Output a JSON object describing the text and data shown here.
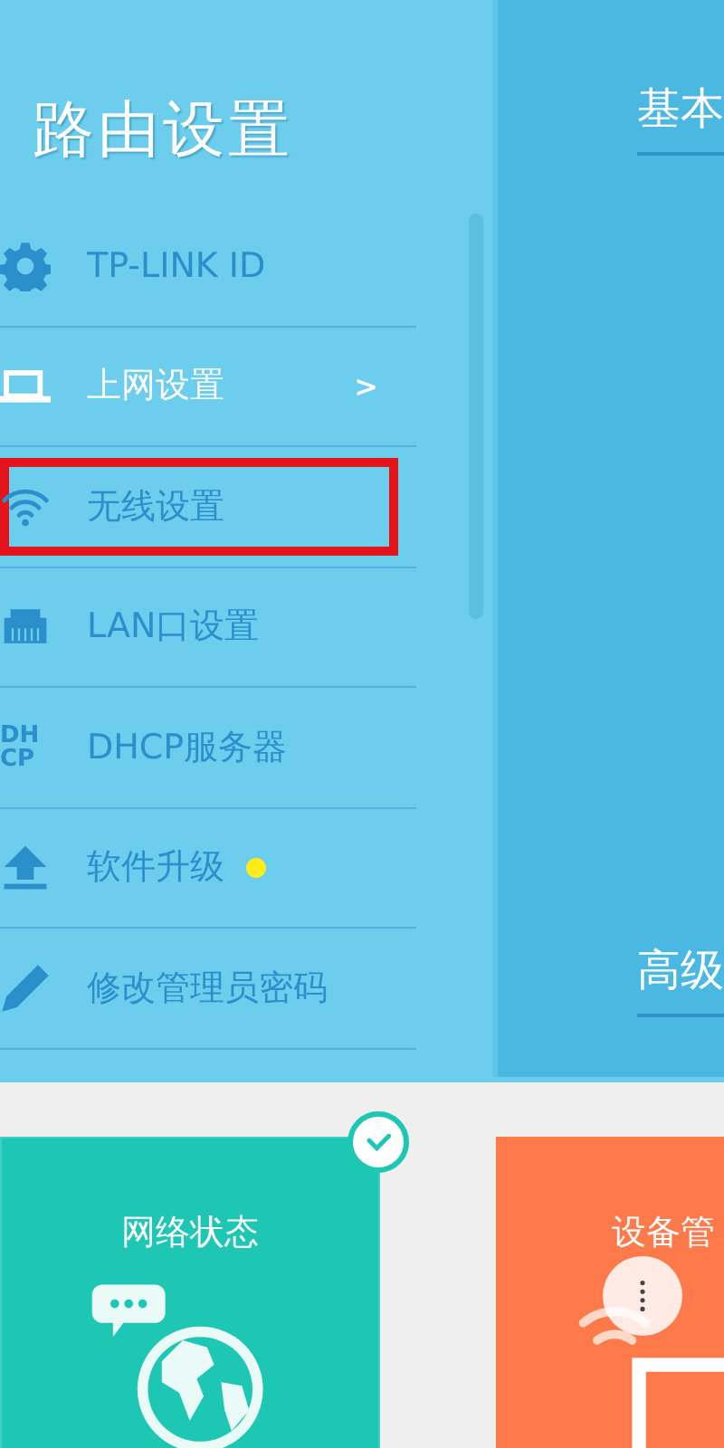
{
  "sidebar": {
    "title": "路由设置",
    "items": [
      {
        "kind": "gear",
        "label": "TP-LINK ID",
        "selected": false,
        "highlighted": false,
        "dot": false
      },
      {
        "kind": "laptop",
        "label": "上网设置",
        "selected": true,
        "highlighted": false,
        "dot": false,
        "chevron": ">"
      },
      {
        "kind": "wifi",
        "label": "无线设置",
        "selected": false,
        "highlighted": true,
        "dot": false
      },
      {
        "kind": "ethernet",
        "label": "LAN口设置",
        "selected": false,
        "highlighted": false,
        "dot": false
      },
      {
        "kind": "dhcp",
        "label": "DHCP服务器",
        "selected": false,
        "highlighted": false,
        "dot": false,
        "icon_text": [
          "DH",
          "CP"
        ]
      },
      {
        "kind": "upload",
        "label": "软件升级",
        "selected": false,
        "highlighted": false,
        "dot": true
      },
      {
        "kind": "pencil",
        "label": "修改管理员密码",
        "selected": false,
        "highlighted": false,
        "dot": false
      }
    ]
  },
  "panel": {
    "sections": [
      "基本",
      "高级"
    ]
  },
  "cards": [
    {
      "kind": "globe",
      "title": "网络状态",
      "checked": true
    },
    {
      "kind": "devices",
      "title": "设备管",
      "checked": false
    }
  ]
}
